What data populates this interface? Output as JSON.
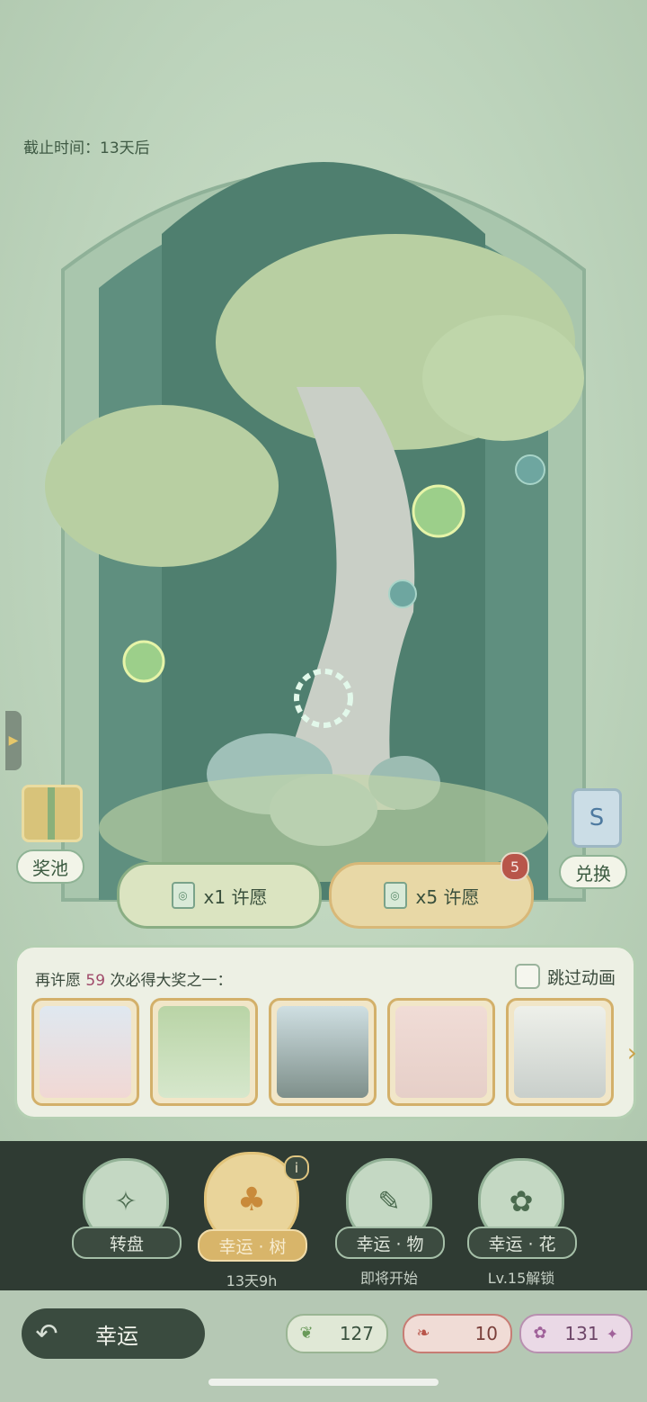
{
  "deadline": "截止时间：13天后",
  "pool_label": "奖池",
  "exchange_label": "兑换",
  "wish1_label": "x1 许愿",
  "wish5_label": "x5 许愿",
  "wish5_badge": "5",
  "progress": {
    "prefix": "再许愿",
    "count": "59",
    "suffix": "次必得大奖之一："
  },
  "skip_label": "跳过动画",
  "modes": [
    {
      "label": "转盘",
      "sub": ""
    },
    {
      "label": "幸运 · 树",
      "sub": "13天9h"
    },
    {
      "label": "幸运 · 物",
      "sub": "即将开始"
    },
    {
      "label": "幸运 · 花",
      "sub": "Lv.15解锁"
    }
  ],
  "back_label": "幸运",
  "currency": {
    "leaf": "127",
    "feather": "10",
    "star": "131"
  },
  "colors": {
    "accent_gold": "#d8b56a",
    "dark_bar": "#2f3b33",
    "panel_border": "#b4cfb2"
  },
  "icons": [
    "gift-icon",
    "exchange-card-icon",
    "ticket-icon",
    "compass-icon",
    "tree-icon",
    "carrot-icon",
    "flower-icon",
    "back-arrow-icon",
    "leaf-icon",
    "feather-icon",
    "star-icon"
  ]
}
